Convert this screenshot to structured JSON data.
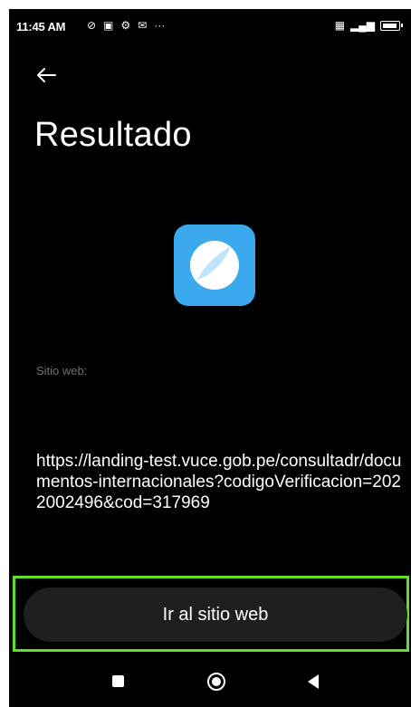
{
  "status_bar": {
    "time": "11:45 AM",
    "left_icons": [
      "silent-icon",
      "message-icon",
      "sync-icon",
      "mail-icon",
      "more-dots-icon"
    ],
    "left_icon_glyphs": [
      "⊘",
      "▣",
      "⚙",
      "✉",
      "···"
    ],
    "right_icons": [
      "sim-icon",
      "signal-icon",
      "battery-icon"
    ],
    "right_icon_glyphs": [
      "▦",
      "▂▄▆"
    ]
  },
  "header": {
    "title": "Resultado"
  },
  "result": {
    "field_label": "Sitio web:",
    "url": "https://landing-test.vuce.gob.pe/consultadr/documentos-internacionales?codigoVerificacion=2022002496&cod=317969"
  },
  "actions": {
    "open_site_label": "Ir al sitio web"
  },
  "colors": {
    "background": "#000000",
    "icon_blue": "#3ba9ee",
    "button_bg": "#1f1f1f",
    "highlight": "#5ee02a"
  }
}
